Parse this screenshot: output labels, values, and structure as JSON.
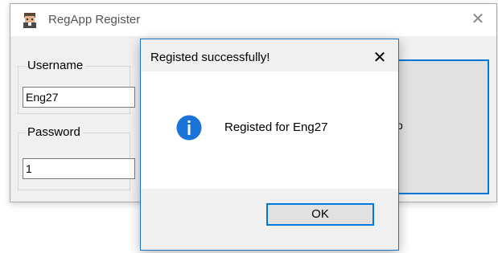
{
  "main_window": {
    "title": "RegApp Register",
    "close_glyph": "✕",
    "icon": "user-avatar-icon",
    "username": {
      "label": "Username",
      "value": "Eng27"
    },
    "password": {
      "label": "Password",
      "value": "1"
    },
    "register_button": {
      "visible_text": "o"
    }
  },
  "dialog": {
    "title": "Registed successfully!",
    "close_glyph": "✕",
    "icon": "info-icon",
    "message": "Registed for Eng27",
    "ok_label": "OK",
    "accent_color": "#0078d7"
  }
}
